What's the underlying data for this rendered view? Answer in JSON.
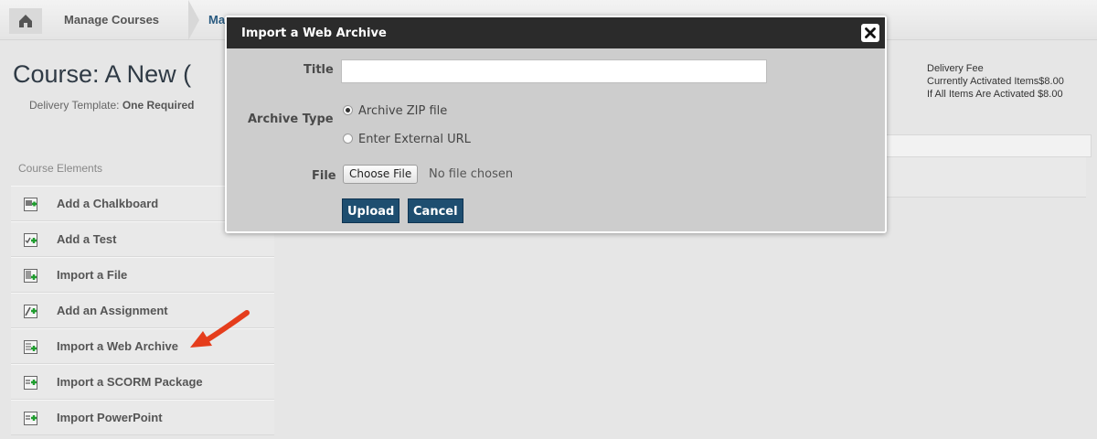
{
  "breadcrumb": {
    "home_icon": "home-icon",
    "items": [
      "Manage Courses",
      "Ma"
    ]
  },
  "course": {
    "title": "Course: A New (",
    "template_label": "Delivery Template:",
    "template_value": "One Required"
  },
  "fees": {
    "heading": "Delivery Fee",
    "rows": [
      {
        "label": "Currently Activated Items",
        "value": "$8.00"
      },
      {
        "label": "If All Items Are Activated",
        "value": "$8.00"
      }
    ]
  },
  "sidebar": {
    "heading": "Course Elements",
    "items": [
      {
        "label": "Add a Chalkboard",
        "icon": "chalkboard-add-icon"
      },
      {
        "label": "Add a Test",
        "icon": "test-add-icon"
      },
      {
        "label": "Import a File",
        "icon": "file-import-icon"
      },
      {
        "label": "Add an Assignment",
        "icon": "assignment-add-icon"
      },
      {
        "label": "Import a Web Archive",
        "icon": "web-archive-import-icon"
      },
      {
        "label": "Import a SCORM Package",
        "icon": "scorm-import-icon"
      },
      {
        "label": "Import PowerPoint",
        "icon": "powerpoint-import-icon"
      }
    ]
  },
  "modal": {
    "title": "Import a Web Archive",
    "close_icon": "close-icon",
    "title_label": "Title",
    "title_value": "",
    "archive_type_label": "Archive Type",
    "options": [
      {
        "label": "Archive ZIP file",
        "selected": true
      },
      {
        "label": "Enter External URL",
        "selected": false
      }
    ],
    "file_label": "File",
    "choose_file": "Choose File",
    "no_file": "No file chosen",
    "upload": "Upload",
    "cancel": "Cancel"
  },
  "colors": {
    "modal_header": "#2b2b2b",
    "button": "#1e4e70",
    "annotation_arrow": "#e53d1c"
  }
}
